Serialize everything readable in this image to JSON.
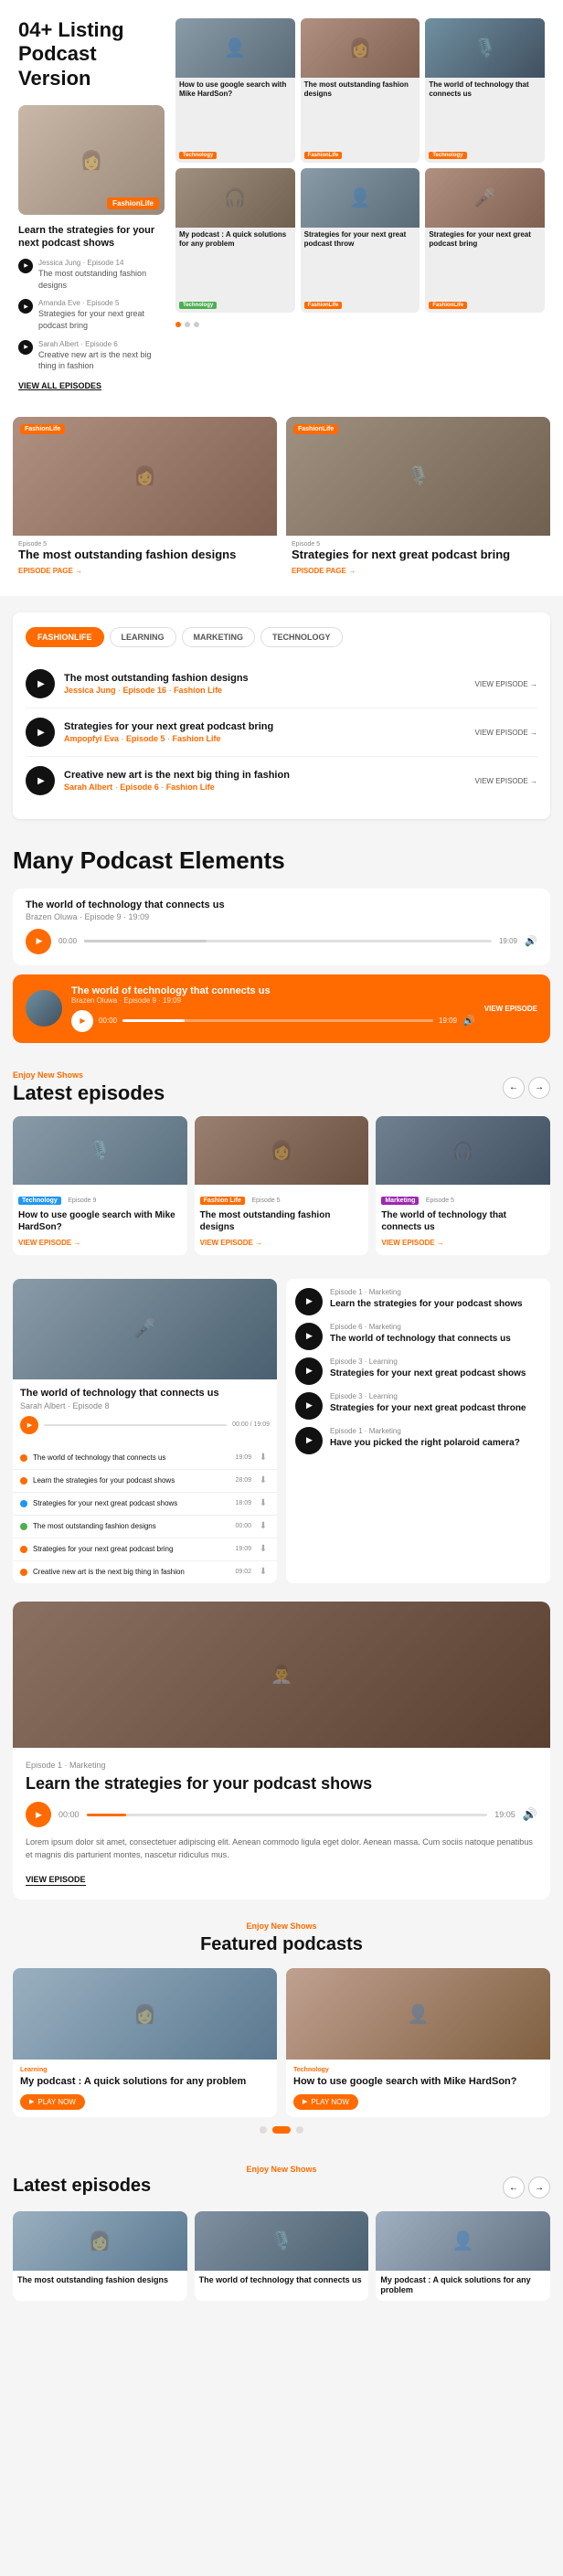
{
  "header": {
    "title": "04+ Listing Podcast Version"
  },
  "hero": {
    "subtitle": "Learn the strategies for your next podcast shows",
    "episodes": [
      {
        "author": "Jessica Jung · Episode 14",
        "title": "The most outstanding fashion designs"
      },
      {
        "author": "Amanda Eve · Episode 5",
        "title": "Strategies for your next great podcast bring"
      },
      {
        "author": "Sarah Albert · Episode 6",
        "title": "Creative new art is the next big thing in fashion"
      }
    ],
    "view_all": "VIEW ALL EPISODES",
    "cards": [
      {
        "tag": "Technology",
        "title": "How to use google search with Mike HardSon?"
      },
      {
        "tag": "FashionLife",
        "title": "The most outstanding fashion designs"
      },
      {
        "tag": "Technology",
        "title": "The world of technology that connects us"
      },
      {
        "tag": "Technology",
        "title": "My podcast : A quick solutions for any problem"
      },
      {
        "tag": "FashionLife",
        "title": "Strategies for your next great podcast throw"
      },
      {
        "tag": "FashionLife",
        "title": "Strategies for your next great podcast bring"
      }
    ]
  },
  "featured_grid": {
    "cards": [
      {
        "tag": "FashionLife",
        "episode": "Episode 5",
        "title": "The most outstanding fashion designs",
        "link": "EPISODE PAGE →"
      },
      {
        "tag": "FashionLife",
        "episode": "Episode 5",
        "title": "Strategies for next great podcast bring",
        "link": "EPISODE PAGE →"
      }
    ]
  },
  "tabs_section": {
    "tabs": [
      "FASHIONLIFE",
      "LEARNING",
      "MARKETING",
      "TECHNOLOGY"
    ],
    "active_tab": "FASHIONLIFE",
    "episodes": [
      {
        "title": "The most outstanding fashion designs",
        "author": "Jessica Jung",
        "episode": "Episode 16",
        "category": "Fashion Life",
        "link": "VIEW EPISODE →"
      },
      {
        "title": "Strategies for your next great podcast bring",
        "author": "Ampopfyi Eva",
        "episode": "Episode 5",
        "category": "Fashion Life",
        "link": "VIEW EPISODE →"
      },
      {
        "title": "Creative new art is the next big thing in fashion",
        "author": "Sarah Albert",
        "episode": "Episode 6",
        "category": "Fashion Life",
        "link": "VIEW EPISODE →"
      }
    ]
  },
  "many_section": {
    "heading": "Many Podcast Elements",
    "player1": {
      "title": "The world of technology that connects us",
      "meta": "Brazen Oluwa · Episode 9 · 19:09",
      "time_current": "00:00",
      "time_total": "19:09"
    },
    "player2": {
      "title": "The world of technology that connects us",
      "meta": "Brazen Oluwa · Episode 9 · 19:09",
      "time_current": "00:00",
      "time_total": "19:09",
      "link": "VIEW EPISODE"
    }
  },
  "latest_episodes": {
    "enjoy_label": "Enjoy New Shows",
    "heading": "Latest episodes",
    "cards": [
      {
        "category": "Technology",
        "episode": "Episode 9",
        "cat_color": "tech",
        "title": "How to use google search with Mike HardSon?",
        "link": "VIEW EPISODE →"
      },
      {
        "category": "Fashion Life",
        "episode": "Episode 5",
        "cat_color": "fashion",
        "title": "The most outstanding fashion designs",
        "link": "VIEW EPISODE →"
      },
      {
        "category": "Marketing",
        "episode": "Episode 5",
        "cat_color": "mkt",
        "title": "The world of technology that connects us",
        "link": "VIEW EPISODE →"
      }
    ]
  },
  "ep_list_section": {
    "left": {
      "title": "The world of technology that connects us",
      "author": "Sarah Albert · Episode 8",
      "time": "00:00 / 19:09",
      "rows": [
        {
          "dot_color": "orange",
          "title": "The world of technology that connects us",
          "time": "19:09"
        },
        {
          "dot_color": "orange",
          "title": "Learn the strategies for your podcast shows",
          "time": "28:09"
        },
        {
          "dot_color": "blue",
          "title": "Strategies for your next great podcast shows",
          "time": "18:09"
        },
        {
          "dot_color": "green",
          "title": "The most outstanding fashion designs",
          "time": "00:00"
        },
        {
          "dot_color": "orange",
          "title": "Strategies for your next great podcast bring",
          "time": "19:09"
        },
        {
          "dot_color": "orange",
          "title": "Creative new art is the next big thing in fashion",
          "time": "09:02"
        }
      ]
    },
    "right": {
      "items": [
        {
          "cat": "Episode 1 · Marketing",
          "title": "Learn the strategies for your podcast shows"
        },
        {
          "cat": "Episode 6 · Marketing",
          "title": "The world of technology that connects us"
        },
        {
          "cat": "Episode 3 · Learning",
          "title": "Strategies for your next great podcast shows"
        },
        {
          "cat": "Episode 3 · Learning",
          "title": "Strategies for your next great podcast throne"
        },
        {
          "cat": "Episode 1 · Marketing",
          "title": "Have you picked the right polaroid camera?"
        }
      ]
    }
  },
  "large_ep_section": {
    "cat": "Episode 1 · Marketing",
    "title": "Learn the strategies for your podcast shows",
    "description": "Lorem ipsum dolor sit amet, consectetuer adipiscing elit. Aenean commodo ligula eget dolor. Aenean massa. Cum sociis natoque penatibus et magnis dis parturient montes, nascetur ridiculus mus.",
    "time_current": "00:00",
    "time_total": "19:05",
    "link": "VIEW EPISODE"
  },
  "featured_section": {
    "enjoy_label": "Enjoy New Shows",
    "heading": "Featured podcasts",
    "cards": [
      {
        "cat": "Learning",
        "title": "My podcast : A quick solutions for any problem",
        "play": "PLAY NOW"
      },
      {
        "cat": "Technology",
        "title": "How to use google search with Mike HardSon?",
        "play": "PLAY NOW"
      }
    ]
  },
  "bottom_latest": {
    "enjoy_label": "Enjoy New Shows",
    "heading": "Latest episodes",
    "cards": [
      {
        "title": "The most outstanding fashion designs"
      },
      {
        "title": "The world of technology that connects us"
      },
      {
        "title": "My podcast : A quick solutions for any problem"
      }
    ]
  }
}
